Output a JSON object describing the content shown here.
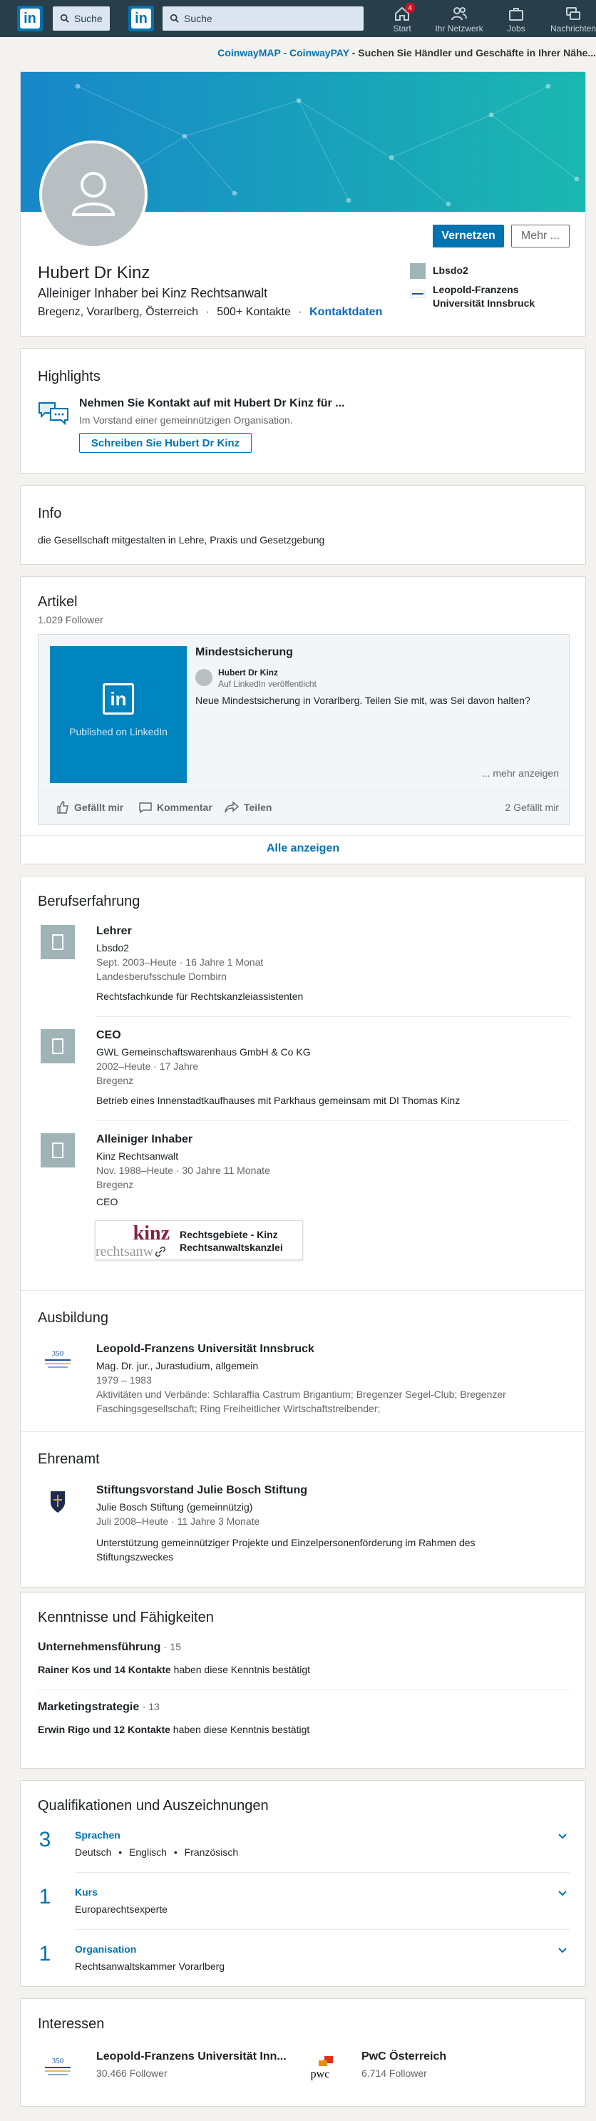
{
  "nav": {
    "search_placeholder_1": "Suche",
    "search_placeholder_2": "Suche",
    "notification_count": "4",
    "items": [
      {
        "label": "Start",
        "icon": "home-icon"
      },
      {
        "label": "Ihr Netzwerk",
        "icon": "network-icon"
      },
      {
        "label": "Jobs",
        "icon": "briefcase-icon"
      },
      {
        "label": "Nachrichten",
        "icon": "messages-icon"
      }
    ]
  },
  "promo": {
    "link": "CoinwayMAP - CoinwayPAY",
    "text": " - Suchen Sie Händler und Geschäfte in Ihrer Nähe..."
  },
  "profile": {
    "name": "Hubert Dr Kinz",
    "headline": "Alleiniger Inhaber bei Kinz Rechtsanwalt",
    "location": "Bregenz, Vorarlberg, Österreich",
    "dot": "·",
    "connections": "500+ Kontakte",
    "contact_info": "Kontaktdaten",
    "connect_button": "Vernetzen",
    "more_button": "Mehr ...",
    "current_company": "Lbsdo2",
    "education_line1": "Leopold-Franzens",
    "education_line2": "Universität Innsbruck"
  },
  "highlights": {
    "title": "Highlights",
    "heading": "Nehmen Sie Kontakt auf mit Hubert Dr Kinz für ...",
    "sub": "Im Vorstand einer gemeinnützigen Organisation.",
    "button": "Schreiben Sie Hubert Dr Kinz"
  },
  "info": {
    "title": "Info",
    "text": "die Gesellschaft mitgestalten in Lehre, Praxis und Gesetzgebung"
  },
  "articles": {
    "title": "Artikel",
    "followers": "1.029 Follower",
    "thumb_text": "Published on LinkedIn",
    "article_title": "Mindestsicherung",
    "author": "Hubert Dr Kinz",
    "published": "Auf LinkedIn veröffentlicht",
    "excerpt": "Neue Mindestsicherung in Vorarlberg. Teilen Sie mit, was Sei davon halten?",
    "more": "... mehr anzeigen",
    "like": "Gefällt mir",
    "comment": "Kommentar",
    "share": "Teilen",
    "likes_count": "2 Gefällt mir",
    "show_all": "Alle anzeigen"
  },
  "experience": {
    "title": "Berufserfahrung",
    "items": [
      {
        "title": "Lehrer",
        "company": "Lbsdo2",
        "period": "Sept. 2003–Heute · 16 Jahre 1 Monat",
        "location": "Landesberufsschule Dornbirn",
        "desc": "Rechtsfachkunde für Rechtskanzleiassistenten"
      },
      {
        "title": "CEO",
        "company": "GWL Gemeinschaftswarenhaus GmbH & Co KG",
        "period": "2002–Heute · 17 Jahre",
        "location": "Bregenz",
        "desc": "Betrieb eines Innenstadtkaufhauses mit Parkhaus gemeinsam mit DI Thomas Kinz"
      },
      {
        "title": "Alleiniger Inhaber",
        "company": "Kinz Rechtsanwalt",
        "period": "Nov. 1988–Heute · 30 Jahre 11 Monate",
        "location": "Bregenz",
        "desc": "CEO",
        "media_logo": "kinz",
        "media_logo_sub": "rechtsanw",
        "media_title_1": "Rechtsgebiete - Kinz",
        "media_title_2": "Rechtsanwaltskanzlei"
      }
    ]
  },
  "education": {
    "title": "Ausbildung",
    "school": "Leopold-Franzens Universität Innsbruck",
    "degree": "Mag. Dr. jur., Jurastudium, allgemein",
    "years": "1979 – 1983",
    "activities_1": "Aktivitäten und Verbände: Schlaraffia Castrum Brigantium; Bregenzer Segel-Club; Bregenzer",
    "activities_2": "Faschingsgesellschaft; Ring Freiheitlicher Wirtschaftstreibender;",
    "logo_text": "350"
  },
  "volunteer": {
    "title": "Ehrenamt",
    "role": "Stiftungsvorstand Julie Bosch Stiftung",
    "org": "Julie Bosch Stiftung (gemeinnützig)",
    "period": "Juli 2008–Heute · 11 Jahre 3 Monate",
    "desc_1": "Unterstützung gemeinnütziger Projekte und Einzelpersonenförderung im Rahmen des",
    "desc_2": "Stiftungszweckes"
  },
  "skills": {
    "title": "Kenntnisse und Fähigkeiten",
    "items": [
      {
        "name": "Unternehmensführung",
        "count": "· 15",
        "endorsers": "Rainer Kos und 14 Kontakte",
        "suffix": " haben diese Kenntnis bestätigt"
      },
      {
        "name": "Marketingstrategie",
        "count": "· 13",
        "endorsers": "Erwin Rigo und 12 Kontakte",
        "suffix": " haben diese Kenntnis bestätigt"
      }
    ]
  },
  "accomplishments": {
    "title": "Qualifikationen und Auszeichnungen",
    "items": [
      {
        "count": "3",
        "label": "Sprachen",
        "values": [
          "Deutsch",
          "Englisch",
          "Französisch"
        ]
      },
      {
        "count": "1",
        "label": "Kurs",
        "values": [
          "Europarechtsexperte"
        ]
      },
      {
        "count": "1",
        "label": "Organisation",
        "values": [
          "Rechtsanwaltskammer Vorarlberg"
        ]
      }
    ],
    "bullet": "•"
  },
  "interests": {
    "title": "Interessen",
    "items": [
      {
        "name": "Leopold-Franzens Universität Inn...",
        "followers": "30.466 Follower",
        "logo": "350"
      },
      {
        "name": "PwC Österreich",
        "followers": "6.714 Follower",
        "logo": "pwc"
      }
    ]
  },
  "colors": {
    "nav_bg": "#283e4a",
    "brand": "#0073b1",
    "banner_from": "#1787c9",
    "banner_to": "#1ab7b0"
  }
}
